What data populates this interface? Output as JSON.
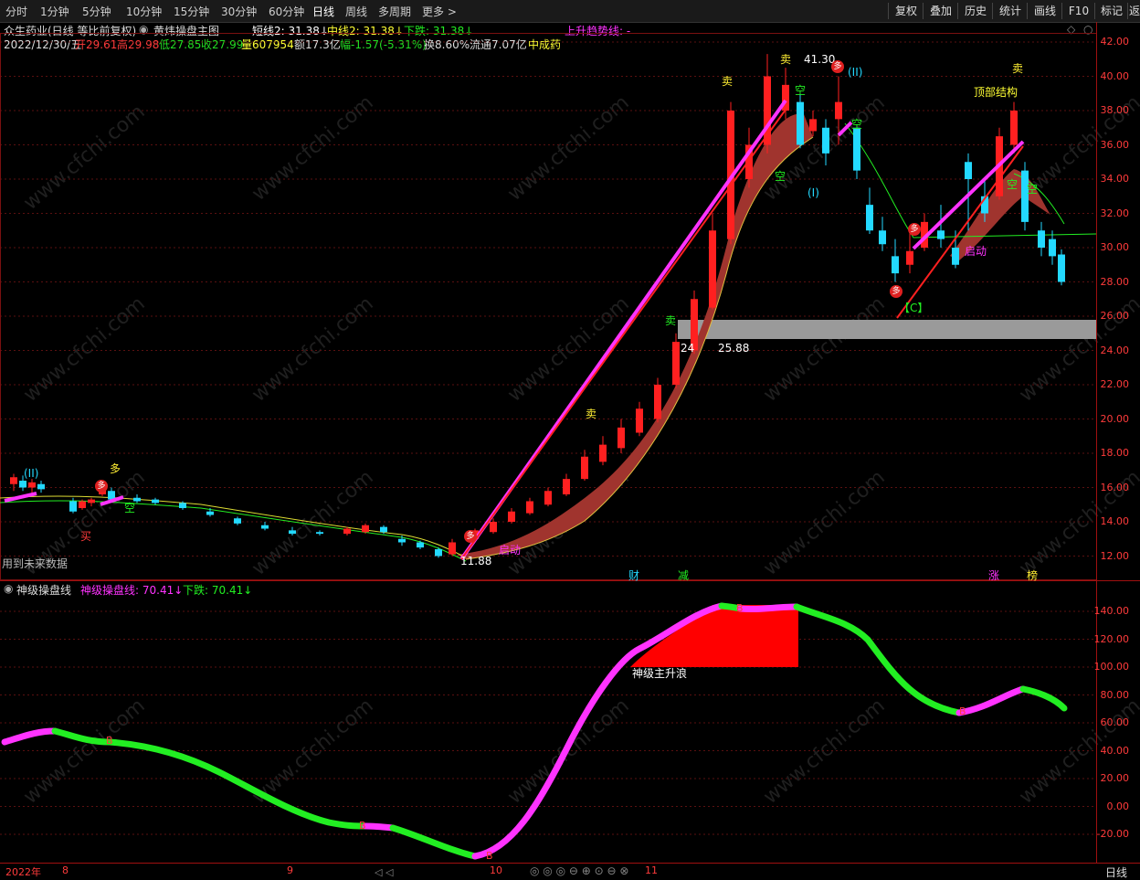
{
  "toolbar": {
    "periods": [
      "分时",
      "1分钟",
      "5分钟",
      "10分钟",
      "15分钟",
      "30分钟",
      "60分钟",
      "日线",
      "周线",
      "多周期",
      "更多 >"
    ],
    "active_period": "日线",
    "right_buttons": [
      "复权",
      "叠加",
      "历史",
      "统计",
      "画线",
      "F10",
      "标记",
      "返回"
    ]
  },
  "header": {
    "stock": "众生药业(日线 等比前复权)",
    "indicator": "黄炜操盘主图",
    "short_line": "短线2: 31.38↓",
    "mid_line": "中线2: 31.38↓",
    "down_line": "下跌: 31.38↓",
    "uptrend": "上升趋势线: -"
  },
  "quote": {
    "date": "2022/12/30/五",
    "open": "开29.61",
    "high": "高29.98",
    "low": "低27.85",
    "close": "收27.99",
    "volume": "量607954",
    "amount": "额17.3亿",
    "change": "幅-1.57(-5.31%)",
    "turnover": "换8.60%",
    "float": "流通7.07亿",
    "sector": "中成药"
  },
  "main_axis": [
    "42.00",
    "40.00",
    "38.00",
    "36.00",
    "34.00",
    "32.00",
    "30.00",
    "28.00",
    "26.00",
    "24.00",
    "22.00",
    "20.00",
    "18.00",
    "16.00",
    "14.00",
    "12.00"
  ],
  "main_annotations": {
    "future_data": "用到未来数据",
    "peak_price": "41.30",
    "support_price": "25.88",
    "support_left": "24",
    "top_structure": "顶部结构",
    "low_price": "11.88",
    "wave_c": "【C】",
    "wave_1": "(II)",
    "wave_2": "(I)",
    "wave_3": "(II)",
    "buy": "买",
    "sell": "卖",
    "long": "多",
    "short": "空",
    "start": "启动",
    "finance": "财",
    "reduce": "减",
    "limit": "涨",
    "rank": "榜"
  },
  "sub": {
    "title": "神级操盘线",
    "line_label": "神级操盘线: 70.41↓",
    "down_label": "下跌: 70.41↓",
    "wave_label": "神级主升浪",
    "axis": [
      "140.00",
      "120.00",
      "100.00",
      "80.00",
      "60.00",
      "40.00",
      "20.00",
      "0.00",
      "-20.00"
    ]
  },
  "bottom": {
    "year": "2022年",
    "months": [
      "8",
      "9",
      "10",
      "11"
    ],
    "period": "日线"
  },
  "colors": {
    "up": "#ff2020",
    "down": "#23d9ff",
    "magenta": "#ff33ff",
    "green": "#22ee22",
    "band": "#a0342e",
    "axis": "#ff3b3b"
  }
}
